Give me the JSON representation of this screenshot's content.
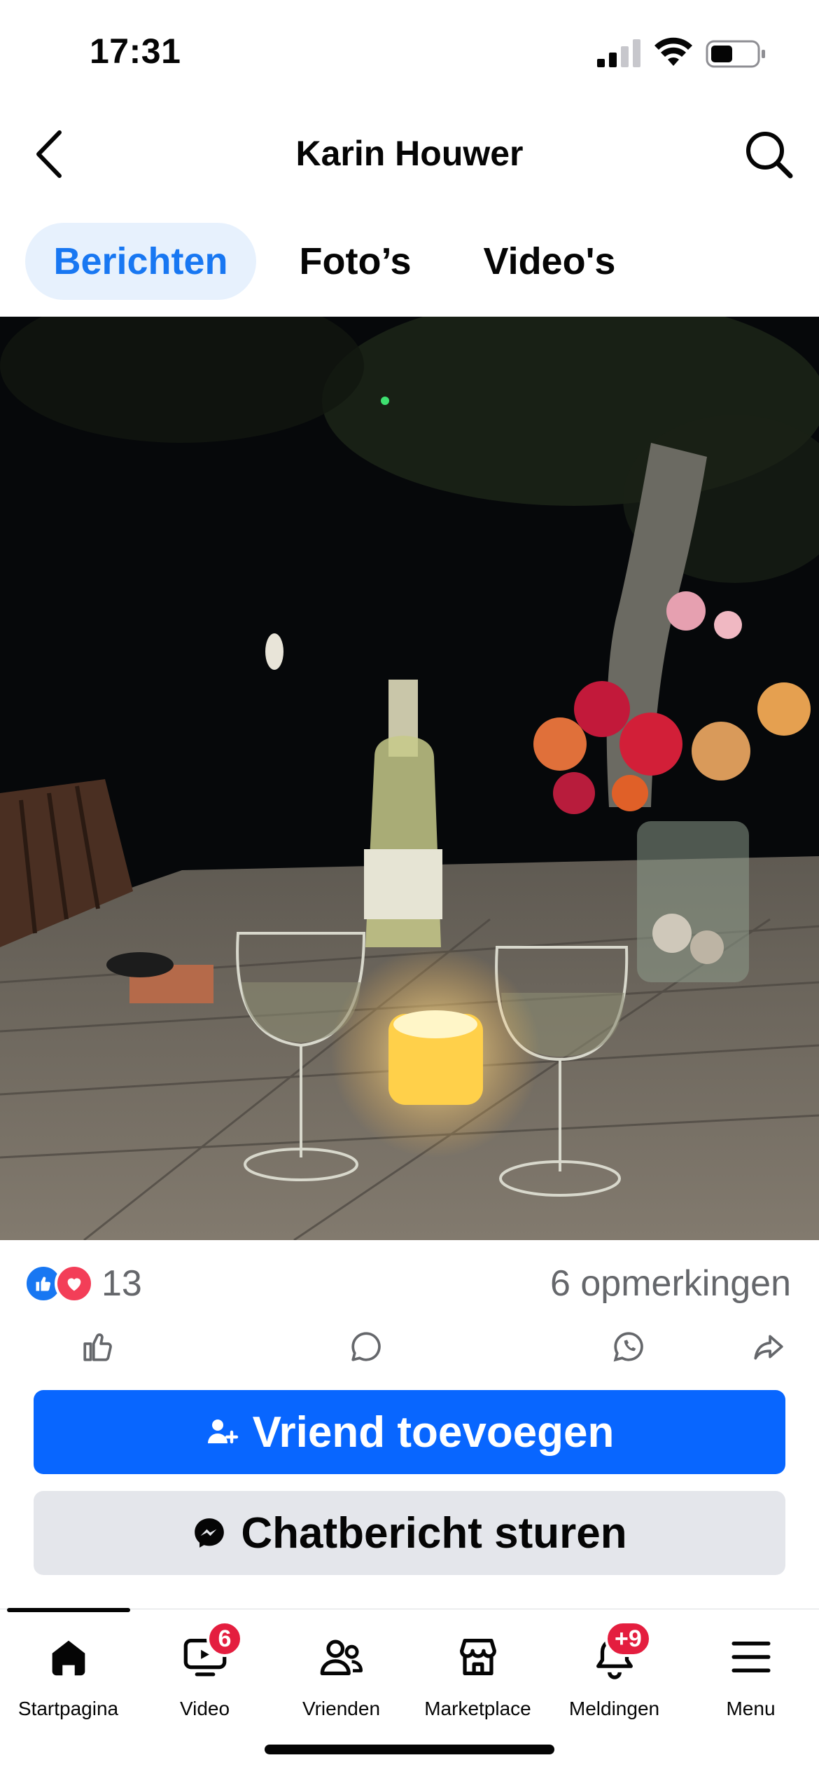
{
  "status_bar": {
    "time": "17:31"
  },
  "header": {
    "title": "Karin Houwer",
    "back_icon": "chevron-left-icon",
    "search_icon": "search-icon"
  },
  "tabs": [
    {
      "label": "Berichten",
      "active": true
    },
    {
      "label": "Foto’s",
      "active": false
    },
    {
      "label": "Video's",
      "active": false
    }
  ],
  "post": {
    "reaction_count": "13",
    "comment_count": "6 opmerkingen",
    "reaction_types": [
      "like-icon",
      "love-icon"
    ],
    "actions": [
      "like-icon",
      "comment-icon",
      "whatsapp-icon",
      "share-icon"
    ]
  },
  "buttons": {
    "add_friend": "Vriend toevoegen",
    "message": "Chatbericht sturen"
  },
  "bottom_nav": [
    {
      "label": "Startpagina",
      "icon": "home-icon",
      "active": true
    },
    {
      "label": "Video",
      "icon": "video-icon",
      "badge": "6"
    },
    {
      "label": "Vrienden",
      "icon": "friends-icon"
    },
    {
      "label": "Marketplace",
      "icon": "marketplace-icon"
    },
    {
      "label": "Meldingen",
      "icon": "bell-icon",
      "badge": "+9"
    },
    {
      "label": "Menu",
      "icon": "menu-icon"
    }
  ],
  "colors": {
    "accent": "#1877f2",
    "primary_button": "#0866ff",
    "badge": "#e41e3f"
  }
}
